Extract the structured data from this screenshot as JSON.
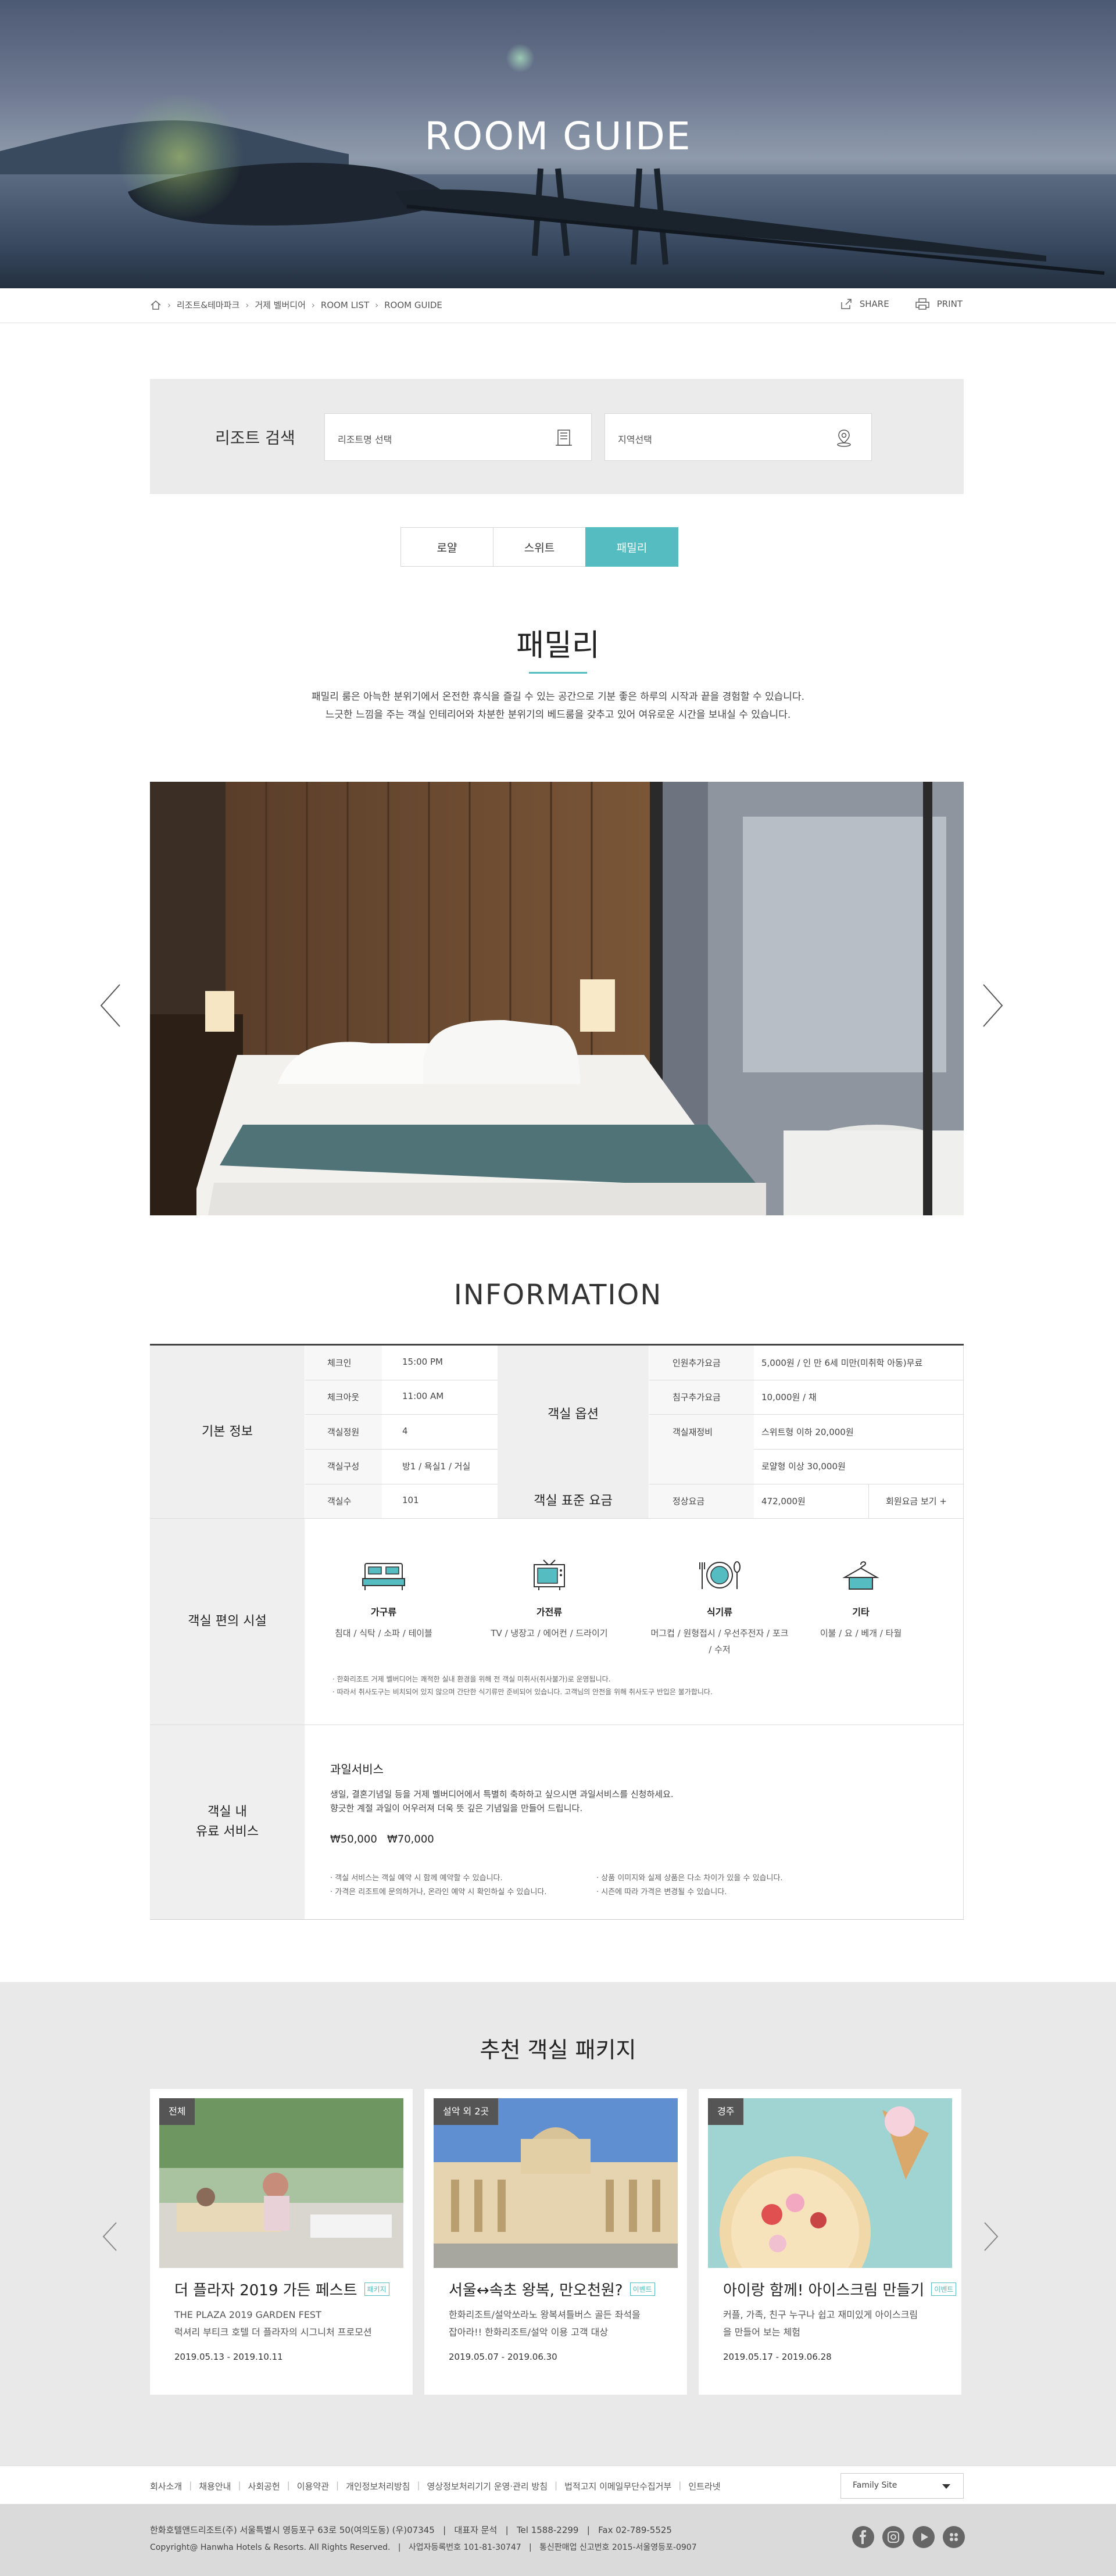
{
  "hero": {
    "title": "ROOM GUIDE"
  },
  "breadcrumb": {
    "items": [
      "리조트&테마파크",
      "거제 벨버디어",
      "ROOM LIST",
      "ROOM GUIDE"
    ],
    "share_label": "SHARE",
    "print_label": "PRINT"
  },
  "search": {
    "label": "리조트 검색",
    "resort_placeholder": "리조트명 선택",
    "region_placeholder": "지역선택"
  },
  "tabs": [
    {
      "label": "로얄",
      "active": false
    },
    {
      "label": "스위트",
      "active": false
    },
    {
      "label": "패밀리",
      "active": true
    }
  ],
  "room": {
    "title": "패밀리",
    "desc_line1": "패밀리 룸은 아늑한 분위기에서 온전한 휴식을 즐길 수 있는 공간으로 기분 좋은 하루의 시작과 끝을 경험할 수 있습니다.",
    "desc_line2": "느긋한 느낌을 주는 객실 인테리어와 차분한 분위기의 베드룸을 갖추고 있어 여유로운 시간을 보내실 수 있습니다."
  },
  "info": {
    "title": "INFORMATION",
    "basic_header": "기본 정보",
    "basic_rows": [
      {
        "label": "체크인",
        "value": "15:00 PM"
      },
      {
        "label": "체크아웃",
        "value": "11:00 AM"
      },
      {
        "label": "객실정원",
        "value": "4"
      },
      {
        "label": "객실구성",
        "value": "방1 / 욕실1 / 거실"
      },
      {
        "label": "객실수",
        "value": "101"
      }
    ],
    "option_header": "객실 옵션",
    "option_rows": [
      {
        "label": "인원추가요금",
        "value": "5,000원 / 인 만 6세 미만(미취학 아동)무료"
      },
      {
        "label": "침구추가요금",
        "value": "10,000원 / 채"
      },
      {
        "label": "객실재정비",
        "value": "스위트형 이하 20,000원"
      },
      {
        "label": "",
        "value": "로얄형 이상 30,000원"
      }
    ],
    "rate_header": "객실 표준 요금",
    "rate_label": "정상요금",
    "rate_value": "472,000원",
    "rate_more": "회원요금 보기 +",
    "amenity_header": "객실 편의 시설",
    "amenities": [
      {
        "icon": "bed-icon",
        "name": "가구류",
        "desc": "침대 / 식탁 / 소파 / 테이블"
      },
      {
        "icon": "tv-icon",
        "name": "가전류",
        "desc": "TV / 냉장고 / 에어컨 / 드라이기"
      },
      {
        "icon": "dining-icon",
        "name": "식기류",
        "desc": "머그컵 / 원형접시 / 우선주전자 / 포크 / 수저"
      },
      {
        "icon": "hanger-icon",
        "name": "기타",
        "desc": "이불 / 요 / 베개 / 타월"
      }
    ],
    "amenity_note1": "· 한화리조트 거제 벨버디어는 쾌적한 실내 환경을 위해 전 객실 미취사(취사불가)로 운영됩니다.",
    "amenity_note2": "· 따라서 취사도구는 비치되어 있지 않으며 간단한 식기류만 준비되어 있습니다. 고객님의 안전을 위해 취사도구 반입은 불가합니다.",
    "paid_header_1": "객실 내",
    "paid_header_2": "유료 서비스",
    "paid_title": "과일서비스",
    "paid_desc1": "생일, 결혼기념일 등을 거제 벨버디어에서 특별히 축하하고 싶으시면 과일서비스를 신청하세요.",
    "paid_desc2": "향긋한 계절 과일이 어우러져 더욱 뜻 깊은 기념일을 만들어 드립니다.",
    "paid_prices": "₩50,000   ₩70,000",
    "paid_note1": "· 객실 서비스는 객실 예약 시 함께 예약할 수 있습니다.",
    "paid_note2": "· 가격은 리조트에 문의하거나, 온라인 예약 시 확인하실 수 있습니다.",
    "paid_note3": "· 상품 이미지와 실제 상품은 다소 차이가 있을 수 있습니다.",
    "paid_note4": "· 시즌에 따라 가격은 변경될 수 있습니다."
  },
  "packages": {
    "title": "추천 객실 패키지",
    "cards": [
      {
        "badge": "전체",
        "title": "더 플라자 2019 가든 페스트",
        "tag": "패키지",
        "line1": "THE PLAZA 2019 GARDEN FEST",
        "line2": "럭셔리 부티크 호텔 더 플라자의 시그니처 프로모션",
        "date": "2019.05.13 - 2019.10.11"
      },
      {
        "badge": "설악 외 2곳",
        "title": "서울↔속초 왕복, 만오천원?",
        "tag": "이벤트",
        "line1": "한화리조트/설악쏘라노 왕복셔틀버스 골든 좌석을",
        "line2": "잡아라!! 한화리조트/설악 이용 고객 대상",
        "date": "2019.05.07 - 2019.06.30"
      },
      {
        "badge": "경주",
        "title": "아이랑 함께! 아이스크림 만들기",
        "tag": "이벤트",
        "line1": "커플, 가족, 친구 누구나 쉽고 재미있게 아이스크림",
        "line2": "을 만들어 보는 체험",
        "date": "2019.05.17 - 2019.06.28"
      }
    ]
  },
  "footer": {
    "links": [
      "회사소개",
      "채용안내",
      "사회공헌",
      "이용약관",
      "개인정보처리방침",
      "영상정보처리기기 운영·관리 방침",
      "법적고지 이메일무단수집거부",
      "인트라넷"
    ],
    "family_site": "Family Site",
    "info1": "한화호텔앤드리조트(주) 서울특별시 영등포구 63로 50(여의도동) (우)07345   |   대표자 문석   |   Tel 1588-2299   |   Fax 02-789-5525",
    "info2": "Copyright@ Hanwha Hotels & Resorts. All Rights Reserved.   |   사업자등록번호 101-81-30747   |   통신판매업 신고번호 2015-서울영등포-0907"
  },
  "colors": {
    "accent": "#55bcc2",
    "dark": "#333333",
    "gray_bg": "#ebebeb"
  }
}
